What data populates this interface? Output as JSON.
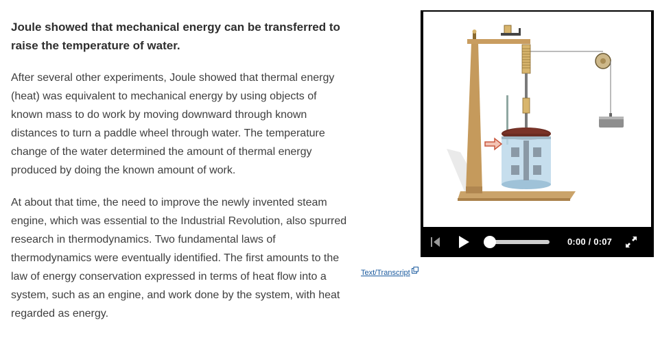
{
  "content": {
    "heading": "Joule showed that mechanical energy can be transferred to raise the temperature of water.",
    "paragraphs": [
      "After several other experiments, Joule showed that thermal energy (heat) was equivalent to mechanical energy by using objects of known mass to do work by moving downward through known distances to turn a paddle wheel through water. The temperature change of the water determined the amount of thermal energy produced by doing the known amount of work.",
      "At about that time, the need to improve the newly invented steam engine, which was essential to the Industrial Revolution, also spurred research in thermodynamics. Two fundamental laws of thermodynamics were eventually identified. The first amounts to the law of energy conservation expressed in terms of heat flow into a system, such as an engine, and work done by the system, with heat regarded as energy."
    ]
  },
  "video": {
    "time_display": "0:00 / 0:07",
    "progress": 0.0,
    "controls": {
      "skip_icon": "skip-to-start-icon",
      "play_icon": "play-icon",
      "fullscreen_icon": "fullscreen-icon"
    }
  },
  "transcript_link": {
    "label": "Text/Transcript",
    "icon": "external-link-icon"
  },
  "colors": {
    "link": "#1a5a9e",
    "player_bg": "#000000",
    "heading_text": "#2f2f2f",
    "body_text": "#3e3e3e"
  }
}
